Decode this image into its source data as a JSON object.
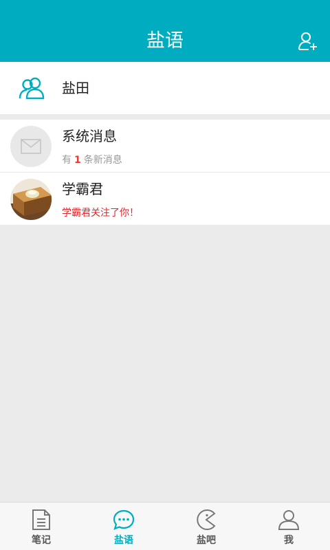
{
  "header": {
    "title": "盐语"
  },
  "group_row": {
    "label": "盐田"
  },
  "conversations": [
    {
      "title": "系统消息",
      "sub_prefix": "有",
      "count": "1",
      "sub_suffix": "条新消息"
    },
    {
      "title": "学霸君",
      "message": "学霸君关注了你！"
    }
  ],
  "tabs": [
    {
      "label": "笔记",
      "icon": "note-icon",
      "active": false
    },
    {
      "label": "盐语",
      "icon": "chat-icon",
      "active": true
    },
    {
      "label": "盐吧",
      "icon": "pacman-icon",
      "active": false
    },
    {
      "label": "我",
      "icon": "user-icon",
      "active": false
    }
  ],
  "colors": {
    "accent": "#00adc0",
    "alert": "#e0262a"
  }
}
